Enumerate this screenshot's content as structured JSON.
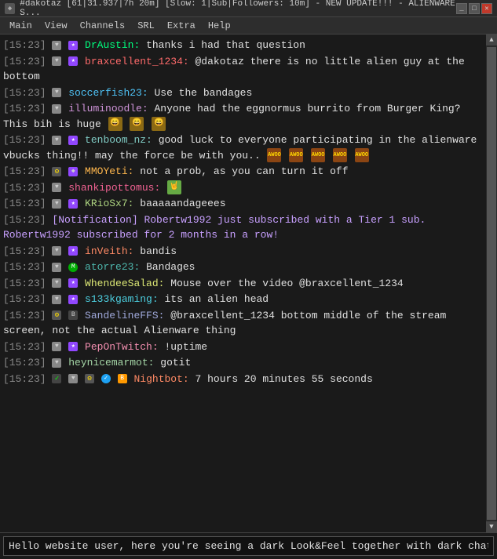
{
  "titlebar": {
    "icon": "♦",
    "title": "#dakotaz [61|31.937|7h 20m] [Slow: 1|Sub|Followers: 10m] - NEW UPDATE!!! - ALIENWARE S...",
    "minimize": "_",
    "maximize": "□",
    "close": "✕"
  },
  "menubar": {
    "items": [
      "Main",
      "View",
      "Channels",
      "SRL",
      "Extra",
      "Help"
    ]
  },
  "chat": {
    "messages": [
      {
        "time": "[15:23]",
        "badges": [
          "heart",
          "sub"
        ],
        "username": "DrAustin:",
        "username_class": "username-DrAustin",
        "text": " thanks i had that question",
        "emotes": []
      },
      {
        "time": "[15:23]",
        "badges": [
          "heart",
          "sub"
        ],
        "username": "braxcellent_1234:",
        "username_class": "username-braxcellent",
        "text": " @dakotaz there is no little alien guy at the bottom",
        "emotes": []
      },
      {
        "time": "[15:23]",
        "badges": [],
        "username": "soccerfish23:",
        "username_class": "username-soccerfish",
        "text": " Use the bandages",
        "emotes": []
      },
      {
        "time": "[15:23]",
        "badges": [
          "heart"
        ],
        "username": "illuminoodle:",
        "username_class": "username-illuminoodle",
        "text": " Anyone had the eggnormus burrito from Burger King? This bih is huge",
        "emotes": [
          "face1",
          "face2",
          "face3"
        ]
      },
      {
        "time": "[15:23]",
        "badges": [
          "heart",
          "sub"
        ],
        "username": "tenboom_nz:",
        "username_class": "username-tenboom",
        "text": " good luck to everyone participating in the alienware vbucks thing!! may the force be with you..",
        "emotes": [
          "awoo",
          "awoo",
          "awoo",
          "awoo",
          "awoo"
        ]
      },
      {
        "time": "[15:23]",
        "badges": [
          "star",
          "bot"
        ],
        "username": "MMOYeti:",
        "username_class": "username-MMOYeti",
        "text": " not a prob, as you can turn it off",
        "emotes": []
      },
      {
        "time": "[15:23]",
        "badges": [
          "heart"
        ],
        "username": "shankipottomus:",
        "username_class": "username-shankipottomus",
        "text": "",
        "emotes": [
          "wave"
        ]
      },
      {
        "time": "[15:23]",
        "badges": [
          "heart",
          "sub"
        ],
        "username": "KRioSx7:",
        "username_class": "username-KRioSx7",
        "text": " baaaaandageees",
        "emotes": []
      },
      {
        "time": "[15:23]",
        "badges": [],
        "username": "",
        "username_class": "username-notification",
        "text": "[Notification] Robertw1992 just subscribed with a Tier 1 sub. Robertw1992 subscribed for 2 months in a row!",
        "emotes": [],
        "is_notification": true
      },
      {
        "time": "[15:23]",
        "badges": [
          "heart",
          "sub"
        ],
        "username": "inVeith:",
        "username_class": "username-inVeith",
        "text": " bandis",
        "emotes": []
      },
      {
        "time": "[15:23]",
        "badges": [
          "heart",
          "mod"
        ],
        "username": "atorre23:",
        "username_class": "username-atorre23",
        "text": " Bandages",
        "emotes": []
      },
      {
        "time": "[15:23]",
        "badges": [
          "heart",
          "sub"
        ],
        "username": "WhendeeSalad:",
        "username_class": "username-WhendeeSalad",
        "text": " Mouse over the video @braxcellent_1234",
        "emotes": []
      },
      {
        "time": "[15:23]",
        "badges": [
          "heart",
          "sub"
        ],
        "username": "s133kgaming:",
        "username_class": "username-s133kgaming",
        "text": " its an alien head",
        "emotes": []
      },
      {
        "time": "[15:23]",
        "badges": [
          "star",
          "bot"
        ],
        "username": "SandelineFFS:",
        "username_class": "username-SandelineFFS",
        "text": " @braxcellent_1234 bottom middle of the stream screen, not the actual Alienware thing",
        "emotes": []
      },
      {
        "time": "[15:23]",
        "badges": [
          "heart",
          "sub"
        ],
        "username": "PepOnTwitch:",
        "username_class": "username-PepOnTwitch",
        "text": " !uptime",
        "emotes": []
      },
      {
        "time": "[15:23]",
        "badges": [
          "heart"
        ],
        "username": "heynicemarmot:",
        "username_class": "username-heynicemarmot",
        "text": " gotit",
        "emotes": []
      },
      {
        "time": "[15:23]",
        "badges": [
          "check",
          "heart",
          "star",
          "verified",
          "bits"
        ],
        "username": "Nightbot:",
        "username_class": "username-Nightbot",
        "text": " 7 hours 20 minutes 55 seconds",
        "emotes": []
      }
    ],
    "input_value": "Hello website user, here you're seeing a dark Look&Feel together with dark chat colors. And also a chat message that I'm not actually going to send. :wink:",
    "input_placeholder": ""
  }
}
